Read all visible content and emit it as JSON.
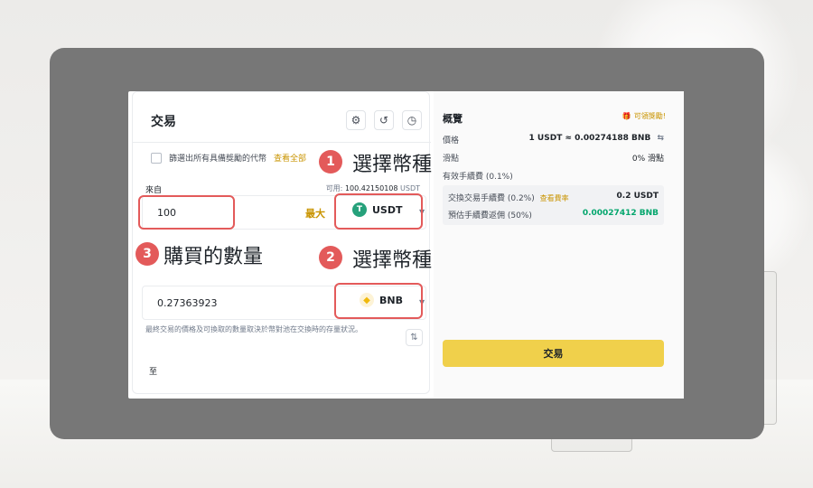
{
  "left": {
    "title": "交易",
    "icons": [
      "gear-icon",
      "refresh-icon",
      "history-icon"
    ],
    "filter_label": "篩選出所有具備獎勵的代幣",
    "filter_link": "查看全部",
    "from_label": "來自",
    "available_label": "可用:",
    "available_value": "100.42150108",
    "available_unit": "USDT",
    "from_amount": "100",
    "max_label": "最大",
    "from_coin": "USDT",
    "to_label": "至",
    "to_amount": "0.27363923",
    "to_coin": "BNB",
    "note": "最終交易的價格及可換取的數量取決於幣對池在交換時的存量狀況。"
  },
  "callouts": {
    "c1_num": "1",
    "c1_text": "選擇幣種",
    "c2_num": "2",
    "c2_text": "選擇幣種",
    "c3_num": "3",
    "c3_text": "購買的數量"
  },
  "right": {
    "title": "概覽",
    "badge": "可領獎勵!",
    "price_label": "價格",
    "price_value": "1 USDT ≈ 0.00274188 BNB",
    "slippage_label": "滑點",
    "slippage_value": "0% 滑點",
    "effective_fee_label": "有效手續費 (0.1%)",
    "swap_fee_label": "交換交易手續費 (0.2%)",
    "swap_fee_link": "查看費率",
    "swap_fee_value": "0.2 USDT",
    "rebate_label": "預估手續費返佣 (50%)",
    "rebate_value": "0.00027412 BNB",
    "trade_button": "交易"
  },
  "colors": {
    "accent_yellow": "#f0d04b",
    "callout_red": "#e35a5a",
    "rebate_green": "#03a66d",
    "link_gold": "#c99400"
  }
}
